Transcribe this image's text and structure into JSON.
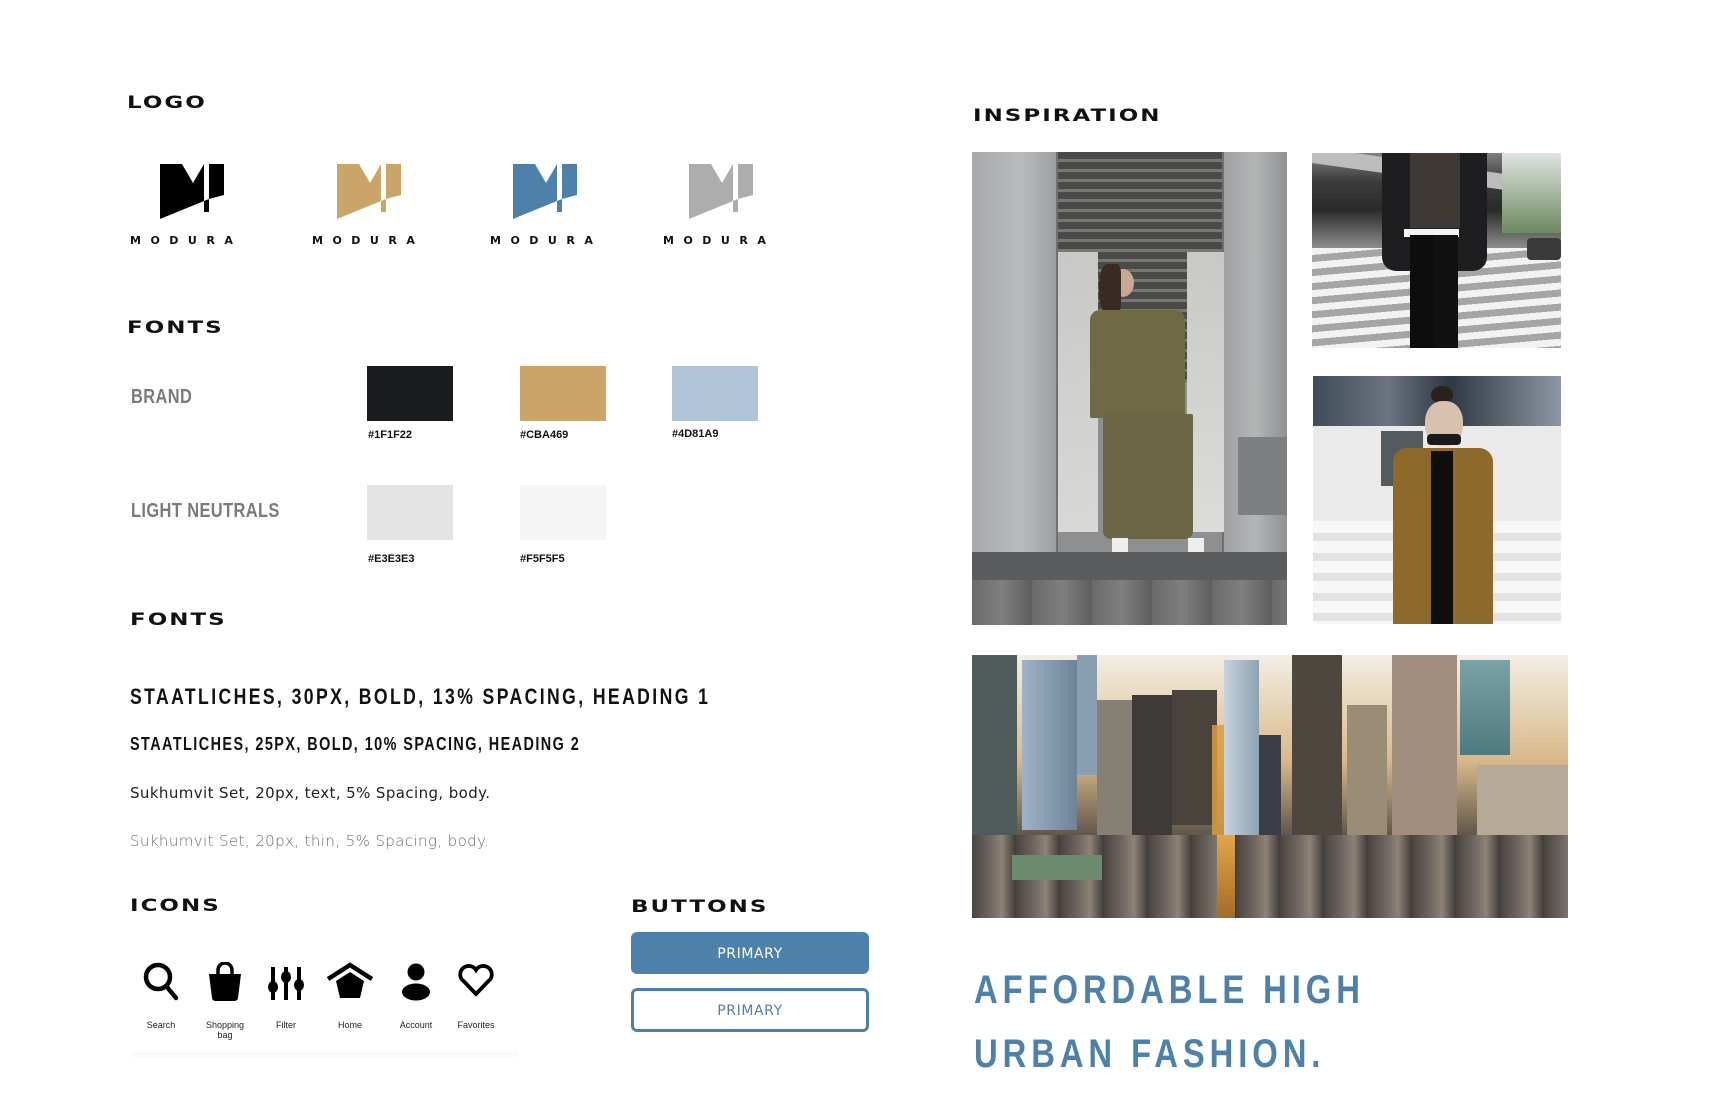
{
  "sections": {
    "logo_title": "LOGO",
    "palette_title": "FONTS",
    "fonts_title": "FONTS",
    "icons_title": "ICONS",
    "buttons_title": "BUTTONS",
    "inspiration_title": "INSPIRATION"
  },
  "logos": [
    {
      "wordmark": "MODURA",
      "color": "#000000"
    },
    {
      "wordmark": "MODURA",
      "color": "#CBA469"
    },
    {
      "wordmark": "MODURA",
      "color": "#4D81A9"
    },
    {
      "wordmark": "MODURA",
      "color": "#ADADAD"
    }
  ],
  "palette": {
    "brand_label": "BRAND",
    "neutrals_label": "LIGHT NEUTRALS",
    "brand": [
      {
        "code": "#1F1F22",
        "display": "#1A1B1F"
      },
      {
        "code": "#CBA469",
        "display": "#CBA469"
      },
      {
        "code": "#4D81A9",
        "display": "#AFC4D8"
      }
    ],
    "neutrals": [
      {
        "code": "#E3E3E3",
        "display": "#E3E3E3"
      },
      {
        "code": "#F5F5F5",
        "display": "#F5F5F5"
      }
    ]
  },
  "fonts": {
    "heading1": "STAATLICHES, 30PX, BOLD, 13% SPACING, HEADING 1",
    "heading2": "STAATLICHES, 25PX, BOLD, 10% SPACING, HEADING 2",
    "body_text": "Sukhumvit Set, 20px, text, 5% Spacing, body.",
    "body_thin": "Sukhumvit Set, 20px, thin, 5% Spacing, body."
  },
  "icons": [
    {
      "name": "search-icon",
      "label": "Search"
    },
    {
      "name": "shopping-bag-icon",
      "label": "Shopping bag"
    },
    {
      "name": "filter-icon",
      "label": "Filter"
    },
    {
      "name": "home-icon",
      "label": "Home"
    },
    {
      "name": "account-icon",
      "label": "Account"
    },
    {
      "name": "heart-icon",
      "label": "Favorites"
    }
  ],
  "buttons": {
    "primary_label": "PRIMARY",
    "outline_label": "PRIMARY",
    "color": "#4D81A9"
  },
  "inspiration": {
    "photos": [
      {
        "name": "photo-woman-olive-outfit",
        "subject": "Woman in olive two-piece under a bridge"
      },
      {
        "name": "photo-man-crosswalk",
        "subject": "Man in black coat on crosswalk"
      },
      {
        "name": "photo-woman-camel-coat",
        "subject": "Woman in camel coat with sunglasses"
      },
      {
        "name": "photo-city-skyline",
        "subject": "City skyline at sunset"
      }
    ],
    "tagline": "AFFORDABLE HIGH URBAN FASHION."
  }
}
